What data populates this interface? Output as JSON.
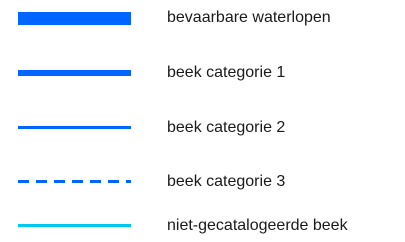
{
  "legend": {
    "items": [
      {
        "label": "bevaarbare waterlopen",
        "line_style": "solid-thick",
        "color": "#0066ff"
      },
      {
        "label": "beek categorie 1",
        "line_style": "solid-medium",
        "color": "#0066ff"
      },
      {
        "label": "beek categorie 2",
        "line_style": "solid-thin",
        "color": "#0066ff"
      },
      {
        "label": "beek categorie 3",
        "line_style": "dashed-thin",
        "color": "#0066ff"
      },
      {
        "label": "niet-gecatalogeerde beek",
        "line_style": "solid-thin",
        "color": "#00c8f0"
      }
    ]
  }
}
